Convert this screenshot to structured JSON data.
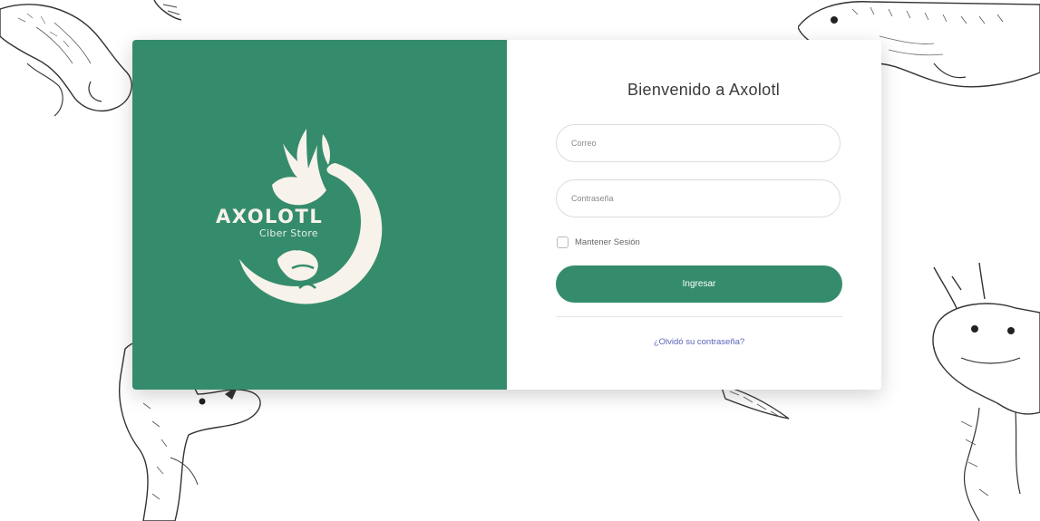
{
  "brand": {
    "name": "AXOLOTL",
    "subtitle": "Ciber Store",
    "panel_color": "#358c6c",
    "logo_color": "#f7f2ea"
  },
  "login": {
    "title": "Bienvenido a Axolotl",
    "email_placeholder": "Correo",
    "password_placeholder": "Contraseña",
    "remember_label": "Mantener Sesión",
    "remember_checked": false,
    "submit_label": "Ingresar",
    "forgot_label": "¿Olvidó su contraseña?",
    "accent_color": "#358c6c",
    "link_color": "#5a63b8"
  },
  "background": {
    "decoration": "axolotl-sketch-illustrations"
  }
}
